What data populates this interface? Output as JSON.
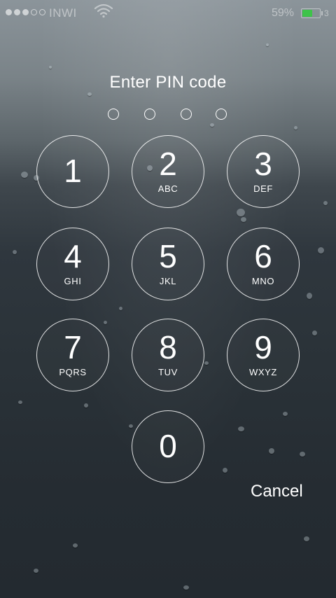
{
  "status_bar": {
    "signal_bars_filled": 3,
    "signal_bars_total": 5,
    "carrier": "INWI",
    "wifi_icon": "wifi-icon",
    "battery_percent_text": "59%",
    "battery_level": 0.59,
    "battery_color": "#3ec34a",
    "extra_number": "3"
  },
  "lock_screen": {
    "title": "Enter PIN code",
    "pin_length": 4,
    "pin_entered": 0,
    "keys": [
      {
        "digit": "1",
        "letters": ""
      },
      {
        "digit": "2",
        "letters": "ABC"
      },
      {
        "digit": "3",
        "letters": "DEF"
      },
      {
        "digit": "4",
        "letters": "GHI"
      },
      {
        "digit": "5",
        "letters": "JKL"
      },
      {
        "digit": "6",
        "letters": "MNO"
      },
      {
        "digit": "7",
        "letters": "PQRS"
      },
      {
        "digit": "8",
        "letters": "TUV"
      },
      {
        "digit": "9",
        "letters": "WXYZ"
      },
      {
        "digit": "0",
        "letters": ""
      }
    ],
    "cancel_label": "Cancel"
  }
}
